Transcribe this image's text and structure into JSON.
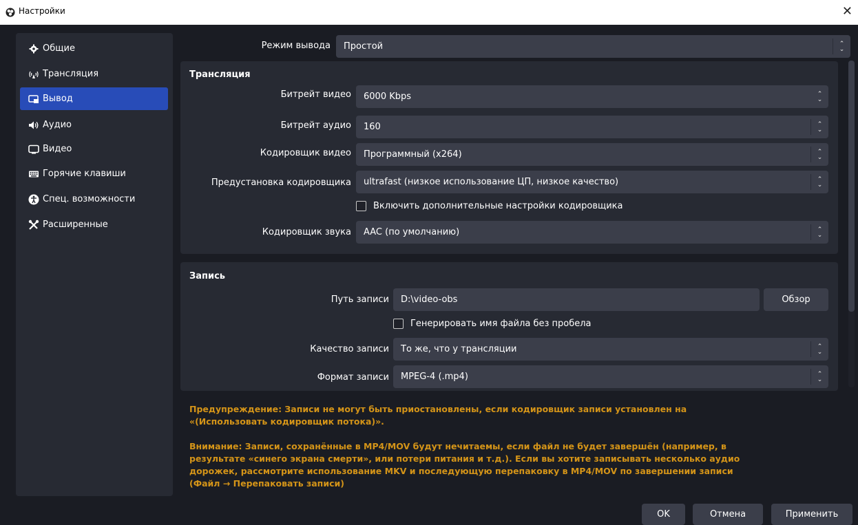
{
  "window": {
    "title": "Настройки",
    "close_glyph": "✕"
  },
  "sidebar": {
    "items": [
      {
        "label": "Общие",
        "icon": "gear-icon"
      },
      {
        "label": "Трансляция",
        "icon": "broadcast-icon"
      },
      {
        "label": "Вывод",
        "icon": "output-icon"
      },
      {
        "label": "Аудио",
        "icon": "speaker-icon"
      },
      {
        "label": "Видео",
        "icon": "monitor-icon"
      },
      {
        "label": "Горячие клавиши",
        "icon": "keyboard-icon"
      },
      {
        "label": "Спец. возможности",
        "icon": "accessibility-icon"
      },
      {
        "label": "Расширенные",
        "icon": "tools-icon"
      }
    ],
    "active_index": 2
  },
  "output_mode": {
    "label": "Режим вывода",
    "value": "Простой"
  },
  "streaming": {
    "title": "Трансляция",
    "video_bitrate_label": "Битрейт видео",
    "video_bitrate_value": "6000 Kbps",
    "audio_bitrate_label": "Битрейт аудио",
    "audio_bitrate_value": "160",
    "video_encoder_label": "Кодировщик видео",
    "video_encoder_value": "Программный (x264)",
    "encoder_preset_label": "Предустановка кодировщика",
    "encoder_preset_value": "ultrafast (низкое использование ЦП, низкое качество)",
    "advanced_checkbox_label": "Включить дополнительные настройки кодировщика",
    "advanced_checked": false,
    "audio_encoder_label": "Кодировщик звука",
    "audio_encoder_value": "AAC (по умолчанию)"
  },
  "recording": {
    "title": "Запись",
    "path_label": "Путь записи",
    "path_value": "D:\\video-obs",
    "browse_label": "Обзор",
    "no_space_checkbox_label": "Генерировать имя файла без пробела",
    "no_space_checked": false,
    "quality_label": "Качество записи",
    "quality_value": "То же, что у трансляции",
    "format_label": "Формат записи",
    "format_value": "MPEG-4 (.mp4)"
  },
  "warnings": {
    "pause_line1": "Предупреждение: Записи не могут быть приостановлены, если кодировщик записи установлен на",
    "pause_line2": "«(Использовать кодировщик потока)».",
    "mp4_line1": "Внимание: Записи, сохранённые в MP4/MOV будут нечитаемы, если файл не будет завершён (например, в",
    "mp4_line2": "результате «синего экрана смерти», или потери питания и т.д.). Если вы хотите записывать несколько аудио",
    "mp4_line3": "дорожек, рассмотрите использование MKV и последующую перепаковку в MP4/MOV по завершении записи",
    "mp4_line4": "(Файл → Перепаковать записи)",
    "color": "#d49418"
  },
  "footer": {
    "ok_label": "OK",
    "cancel_label": "Отмена",
    "apply_label": "Применить"
  },
  "colors": {
    "accent": "#284cb8",
    "background": "#1a1c23",
    "panel": "#272a33",
    "control": "#3b3e4a"
  }
}
